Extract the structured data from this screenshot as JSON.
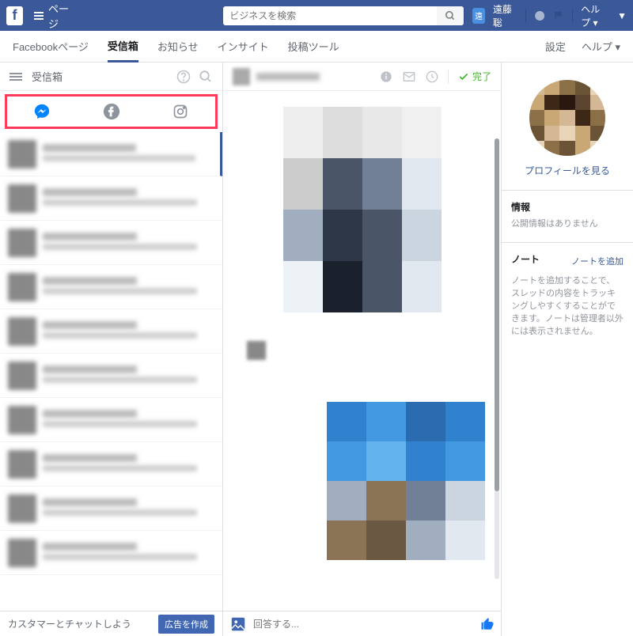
{
  "topnav": {
    "page_label": "ページ",
    "search_placeholder": "ビジネスを検索",
    "user_badge": "遠",
    "user_name": "遠藤 聡",
    "help_label": "ヘルプ"
  },
  "subnav": {
    "items": [
      "Facebookページ",
      "受信箱",
      "お知らせ",
      "インサイト",
      "投稿ツール"
    ],
    "active_index": 1,
    "right_items": [
      "設定",
      "ヘルプ ▾"
    ]
  },
  "sidebar": {
    "title": "受信箱",
    "footer_text": "カスタマーとチャットしよう",
    "ad_button": "広告を作成"
  },
  "chat_header": {
    "done_label": "完了"
  },
  "chat_footer": {
    "reply_placeholder": "回答する..."
  },
  "right_panel": {
    "profile_link": "プロフィールを見る",
    "info_title": "情報",
    "info_text": "公開情報はありません",
    "note_title": "ノート",
    "note_add": "ノートを追加",
    "note_desc": "ノートを追加することで、スレッドの内容をトラッキングしやすくすることができます。ノートは管理者以外には表示されません。"
  }
}
